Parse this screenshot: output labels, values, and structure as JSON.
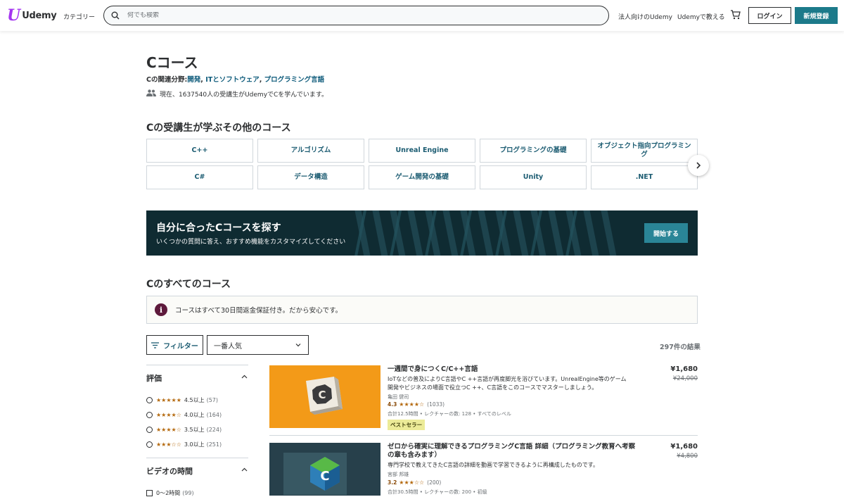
{
  "header": {
    "logo_text": "Udemy",
    "categories_label": "カテゴリー",
    "search_placeholder": "何でも検索",
    "business_link": "法人向けのUdemy",
    "teach_link": "Udemyで教える",
    "login_label": "ログイン",
    "signup_label": "新規登録"
  },
  "page": {
    "title": "Cコース",
    "related_prefix": "Cの関連分野:",
    "related_links": [
      "開発",
      "ITとソフトウェア",
      "プログラミング言語"
    ],
    "learners_text": "現在、1637540人の受講生がUdemyでCを学んでいます。"
  },
  "other_courses": {
    "heading": "Cの受講生が学ぶその他のコース",
    "topics": [
      "C++",
      "アルゴリズム",
      "Unreal Engine",
      "プログラミングの基礎",
      "オブジェクト指向プログラミング",
      "C#",
      "データ構造",
      "ゲーム開発の基礎",
      "Unity",
      ".NET"
    ]
  },
  "banner": {
    "title": "自分に合ったCコースを探す",
    "subtitle": "いくつかの質問に答え、おすすめ機能をカスタマイズしてください",
    "button_label": "開始する",
    "bg_color": "#0f2b32"
  },
  "all_courses": {
    "heading": "Cのすべてのコース",
    "notice": "コースはすべて30日間返金保証付き。だから安心です。",
    "filter_label": "フィルター",
    "sort_value": "一番人気",
    "results_count": "297件の結果"
  },
  "sidebar": {
    "rating_title": "評価",
    "ratings": [
      {
        "stars": "★★★★★",
        "label": "4.5以上",
        "count": "(57)"
      },
      {
        "stars": "★★★★☆",
        "label": "4.0以上",
        "count": "(164)"
      },
      {
        "stars": "★★★★☆",
        "label": "3.5以上",
        "count": "(224)"
      },
      {
        "stars": "★★★☆☆",
        "label": "3.0以上",
        "count": "(251)"
      }
    ],
    "video_title": "ビデオの時間",
    "video_options": [
      {
        "label": "0〜2時間",
        "count": "(99)"
      }
    ]
  },
  "courses": [
    {
      "title": "一週間で身につくC/C++言語",
      "description": "IoTなどの普及によりC言語やC ++言語が再度脚光を浴びています。UnrealEngine等のゲーム開発やビジネスの場面で役立つC ++、C言語をこのコースでマスターしましょう。",
      "instructor": "亀田 健司",
      "rating": "4.3",
      "stars": "★★★★☆",
      "reviews": "(1033)",
      "meta": "合計12.5時間 • レクチャーの数: 128 • すべてのレベル",
      "badge": "ベストセラー",
      "price": "¥1,680",
      "original_price": "¥24,000"
    },
    {
      "title": "ゼロから確実に理解できるプログラミングC言語 詳細（プログラミング教育へ考察の章も含みます）",
      "description": "専門学校で教えてきたC言語の詳細を動画で学習できるように再構成したものです。",
      "instructor": "宮部 邦雄",
      "rating": "3.2",
      "stars": "★★★☆☆",
      "reviews": "(200)",
      "meta": "合計30.5時間 • レクチャーの数: 200 • 初級",
      "price": "¥1,680",
      "original_price": "¥4,800"
    }
  ]
}
